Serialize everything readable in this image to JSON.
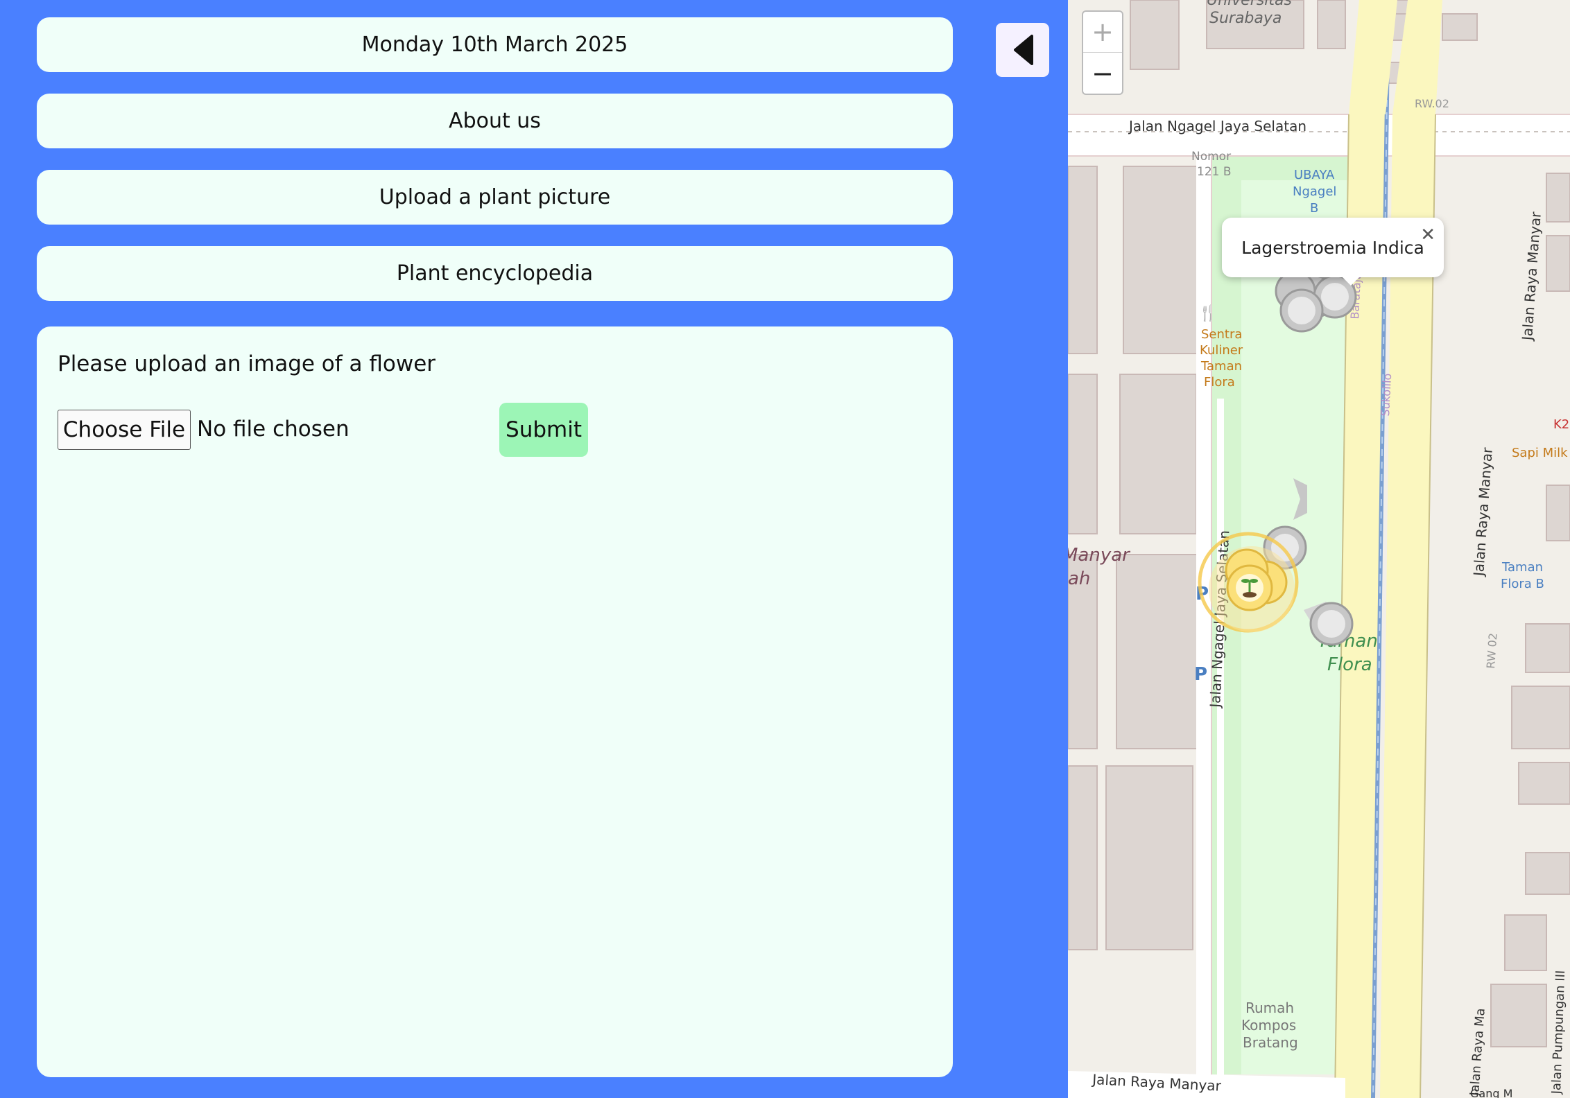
{
  "nav": {
    "date_label": "Monday 10th March 2025",
    "about_label": "About us",
    "upload_label": "Upload a plant picture",
    "encyclopedia_label": "Plant encyclopedia"
  },
  "upload_form": {
    "prompt": "Please upload an image of a flower",
    "choose_file_label": "Choose File",
    "file_status": "No file chosen",
    "submit_label": "Submit"
  },
  "sidebar_toggle": {
    "icon": "triangle-left-icon"
  },
  "map": {
    "zoom_in": "+",
    "zoom_out": "−",
    "popup": {
      "text": "Lagerstroemia Indica",
      "close": "✕"
    },
    "labels": {
      "universitas": "Universitas",
      "surabaya": "Surabaya",
      "jalan_ngagel_jaya": "Jalan Ngagel Jaya Selatan",
      "nomor": "Nomor",
      "nomor_num": "121 B",
      "ubaya1": "UBAYA",
      "ubaya2": "Ngagel",
      "ubaya3": "B",
      "sentra1": "Sentra",
      "sentra2": "Kuliner",
      "sentra3": "Taman",
      "sentra4": "Flora",
      "rw02_top": "RW.02",
      "baratajaya": "Baratajaya",
      "sukolilo": "Sukolilo",
      "k24": "K2",
      "sapi_milk": "Sapi Milk",
      "jalan_raya_manyar_right": "Jalan Raya Manyar",
      "jalan_raya_manyar_mid": "Jalan Raya Manyar",
      "taman_flora_b1": "Taman",
      "taman_flora_b2": "Flora B",
      "rw02_mid": "RW 02",
      "manyar1": "Manyar",
      "manyar2": "ah",
      "jalan_ngagel_vert": "Jalan Ngagel Jaya Selatan",
      "taman1": "Taman",
      "taman2": "Flora",
      "rumah1": "Rumah",
      "rumah2": "Kompos",
      "rumah3": "Bratang",
      "jalan_raya_manyar_bottom": "Jalan Raya Manyar",
      "jalan_raya_manyar_m": "Jalan Raya Ma",
      "jalan_pumpungan": "Jalan Pumpungan III",
      "gang": "Gang M"
    }
  }
}
